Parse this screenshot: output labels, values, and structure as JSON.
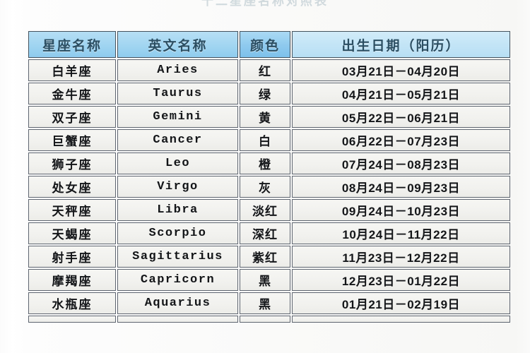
{
  "page": {
    "title_strip_text": "十二星座名称对照表",
    "background_color": "#ffffff"
  },
  "table": {
    "name": "zodiac-sign-reference-table",
    "header_accent_color": "#8ec9ec",
    "border_color": "#5f6670",
    "row_background": "#efefec",
    "columns": [
      {
        "key": "name",
        "label": "星座名称"
      },
      {
        "key": "en",
        "label": "英文名称"
      },
      {
        "key": "color",
        "label": "颜色"
      },
      {
        "key": "date",
        "label": "出生日期（阳历）"
      }
    ],
    "rows": [
      {
        "name": "白羊座",
        "en": "Aries",
        "color": "红",
        "date": "03月21日－04月20日"
      },
      {
        "name": "金牛座",
        "en": "Taurus",
        "color": "绿",
        "date": "04月21日－05月21日"
      },
      {
        "name": "双子座",
        "en": "Gemini",
        "color": "黄",
        "date": "05月22日－06月21日"
      },
      {
        "name": "巨蟹座",
        "en": "Cancer",
        "color": "白",
        "date": "06月22日－07月23日"
      },
      {
        "name": "狮子座",
        "en": "Leo",
        "color": "橙",
        "date": "07月24日－08月23日"
      },
      {
        "name": "处女座",
        "en": "Virgo",
        "color": "灰",
        "date": "08月24日－09月23日"
      },
      {
        "name": "天秤座",
        "en": "Libra",
        "color": "淡红",
        "date": "09月24日－10月23日"
      },
      {
        "name": "天蝎座",
        "en": "Scorpio",
        "color": "深红",
        "date": "10月24日－11月22日"
      },
      {
        "name": "射手座",
        "en": "Sagittarius",
        "color": "紫红",
        "date": "11月23日－12月22日"
      },
      {
        "name": "摩羯座",
        "en": "Capricorn",
        "color": "黑",
        "date": "12月23日－01月22日"
      },
      {
        "name": "水瓶座",
        "en": "Aquarius",
        "color": "黑",
        "date": "01月21日－02月19日"
      }
    ]
  }
}
